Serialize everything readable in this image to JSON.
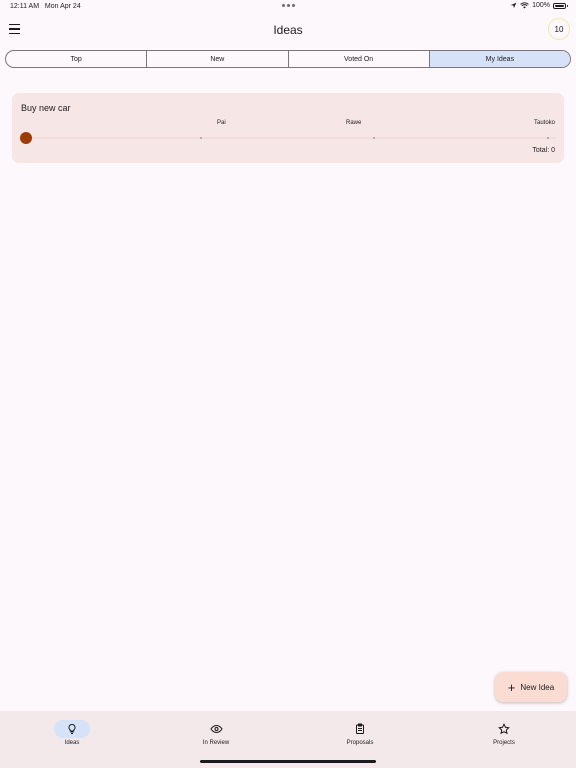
{
  "status_bar": {
    "time": "12:11 AM",
    "date": "Mon Apr 24",
    "battery": "100%"
  },
  "app_bar": {
    "title": "Ideas",
    "counter": "10"
  },
  "tabs": [
    {
      "label": "Top",
      "active": false
    },
    {
      "label": "New",
      "active": false
    },
    {
      "label": "Voted On",
      "active": false
    },
    {
      "label": "My Ideas",
      "active": true
    }
  ],
  "idea": {
    "title": "Buy new car",
    "vote_labels": [
      "Pai",
      "Rawe",
      "Tautoko"
    ],
    "vote_value": 0,
    "total": "Total: 0"
  },
  "fab": {
    "label": "New Idea",
    "icon": "plus-icon"
  },
  "bottom_nav": [
    {
      "label": "Ideas",
      "icon": "lightbulb-icon",
      "active": true
    },
    {
      "label": "In Review",
      "icon": "eye-icon",
      "active": false
    },
    {
      "label": "Proposals",
      "icon": "clipboard-icon",
      "active": false
    },
    {
      "label": "Projects",
      "icon": "star-icon",
      "active": false
    }
  ],
  "colors": {
    "background": "#fdf8fb",
    "card": "#f6e6e5",
    "active_tab": "#d6e2f8",
    "thumb": "#9e3c05",
    "fab": "#fbdcd2",
    "nav_bg": "#f3e9ea"
  }
}
